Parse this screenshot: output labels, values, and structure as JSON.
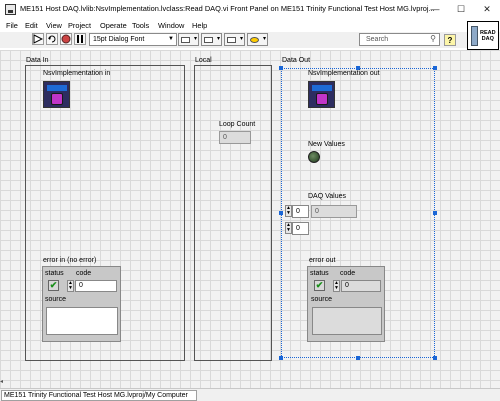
{
  "window": {
    "title": "ME151 Host DAQ.lvlib:NsvImplementation.lvclass:Read DAQ.vi Front Panel on ME151 Trinity Functional Test Host MG.lvproj...",
    "minimize": "—",
    "maximize": "☐",
    "close": "✕"
  },
  "menu": [
    "File",
    "Edit",
    "View",
    "Project",
    "Operate",
    "Tools",
    "Window",
    "Help"
  ],
  "toolbar": {
    "run_icon": "run-arrow-icon",
    "font": "15pt Dialog Font",
    "search_placeholder": "Search",
    "help_label": "?",
    "vi_icon_text": "READ\nDAQ"
  },
  "panel": {
    "data_in": {
      "label": "Data In",
      "nsv_in_label": "NsvImplementation in",
      "error_in": {
        "label": "error in (no error)",
        "status_label": "status",
        "code_label": "code",
        "code_value": "0",
        "source_label": "source",
        "status_check": "✔"
      }
    },
    "local": {
      "label": "Local",
      "loop_count_label": "Loop Count",
      "loop_count_value": "0"
    },
    "data_out": {
      "label": "Data Out",
      "nsv_out_label": "NsvImplementation out",
      "new_values_label": "New Values",
      "daq_values_label": "DAQ Values",
      "daq_index_1": "0",
      "daq_index_2": "0",
      "daq_value": "0",
      "error_out": {
        "label": "error out",
        "status_label": "status",
        "code_label": "code",
        "code_value": "0",
        "source_label": "source",
        "status_check": "✔"
      }
    }
  },
  "status_bar": {
    "path": "ME151 Trinity Functional Test Host MG.lvproj/My Computer"
  }
}
